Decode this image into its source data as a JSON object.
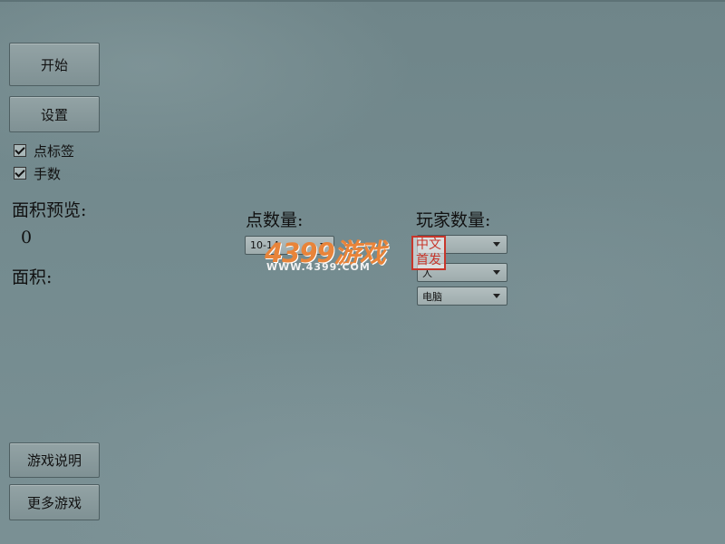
{
  "menu": {
    "start_label": "开始",
    "settings_label": "设置",
    "instructions_label": "游戏说明",
    "more_games_label": "更多游戏"
  },
  "options": {
    "point_labels": {
      "label": "点标签",
      "checked": true
    },
    "move_count": {
      "label": "手数",
      "checked": true
    }
  },
  "stats": {
    "area_preview_label": "面积预览:",
    "area_preview_value": "0",
    "area_label": "面积:"
  },
  "config": {
    "point_count_label": "点数量:",
    "point_count_value": "10-14",
    "player_count_label": "玩家数量:",
    "player_count_value": "",
    "player1_type": "人",
    "player2_type": "电脑"
  },
  "watermark": {
    "brand": "4399游戏",
    "url": "WWW.4399.COM",
    "seal": "中文首发"
  },
  "colors": {
    "background": "#748b8f",
    "watermark_orange": "#e8843a",
    "seal_red": "#c7362b"
  }
}
